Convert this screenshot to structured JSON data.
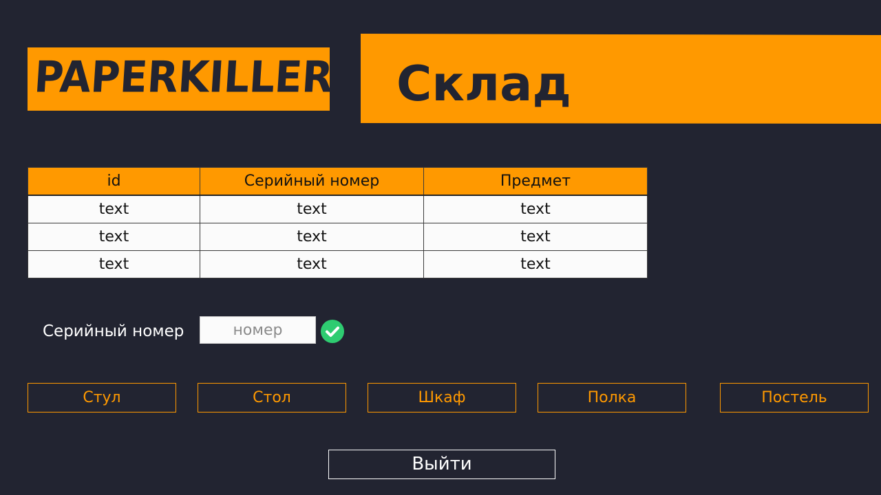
{
  "header": {
    "logo_text": "PAPERKILLER",
    "page_title": "Склад"
  },
  "table": {
    "columns": [
      "id",
      "Серийный номер",
      "Предмет"
    ],
    "rows": [
      [
        "text",
        "text",
        "text"
      ],
      [
        "text",
        "text",
        "text"
      ],
      [
        "text",
        "text",
        "text"
      ]
    ]
  },
  "serial": {
    "label": "Серийный номер",
    "value": "",
    "placeholder": "номер",
    "confirm_icon": "check-circle-icon"
  },
  "categories": [
    {
      "label": "Стул"
    },
    {
      "label": "Стол"
    },
    {
      "label": "Шкаф"
    },
    {
      "label": "Полка"
    },
    {
      "label": "Постель"
    }
  ],
  "exit_label": "Выйти",
  "colors": {
    "background": "#222431",
    "accent": "#ff9900",
    "confirm": "#2ecc71",
    "table_row": "#fbfbfb"
  }
}
